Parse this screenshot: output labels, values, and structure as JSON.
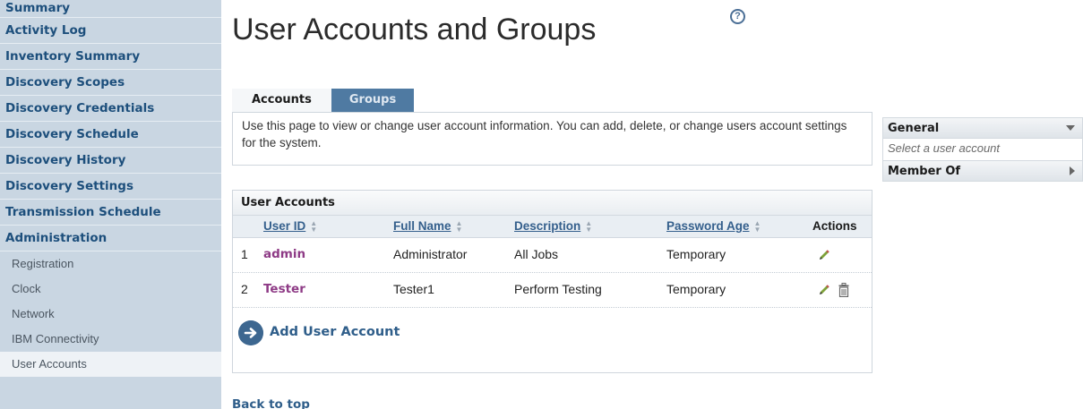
{
  "sidebar": {
    "items": [
      {
        "label": "Summary"
      },
      {
        "label": "Activity Log"
      },
      {
        "label": "Inventory Summary"
      },
      {
        "label": "Discovery Scopes"
      },
      {
        "label": "Discovery Credentials"
      },
      {
        "label": "Discovery Schedule"
      },
      {
        "label": "Discovery History"
      },
      {
        "label": "Discovery Settings"
      },
      {
        "label": "Transmission Schedule"
      },
      {
        "label": "Administration"
      }
    ],
    "subitems": [
      {
        "label": "Registration"
      },
      {
        "label": "Clock"
      },
      {
        "label": "Network"
      },
      {
        "label": "IBM Connectivity"
      },
      {
        "label": "User Accounts",
        "active": true
      }
    ]
  },
  "page": {
    "title": "User Accounts and Groups",
    "help_icon": "?",
    "tabs": [
      {
        "label": "Accounts",
        "active": true
      },
      {
        "label": "Groups",
        "active": false
      }
    ],
    "description": "Use this page to view or change user account information. You can add, delete, or change users account settings for the system.",
    "back_to_top": "Back to top"
  },
  "user_accounts": {
    "heading": "User Accounts",
    "columns": {
      "user_id": "User ID",
      "full_name": "Full Name",
      "description": "Description",
      "password_age": "Password Age",
      "actions": "Actions"
    },
    "rows": [
      {
        "num": "1",
        "user_id": "admin",
        "full_name": "Administrator",
        "description": "All Jobs",
        "password_age": "Temporary",
        "can_delete": false
      },
      {
        "num": "2",
        "user_id": "Tester",
        "full_name": "Tester1",
        "description": "Perform Testing",
        "password_age": "Temporary",
        "can_delete": true
      }
    ],
    "add_label": "Add User Account"
  },
  "right_panel": {
    "general_label": "General",
    "general_placeholder": "Select a user account",
    "member_of_label": "Member Of"
  },
  "colors": {
    "sidebar_bg": "#c9d6e2",
    "nav_text": "#1d4f7c",
    "tab_inactive": "#4f7aa2",
    "link": "#2f5e8a",
    "user_id": "#8e3b86"
  }
}
